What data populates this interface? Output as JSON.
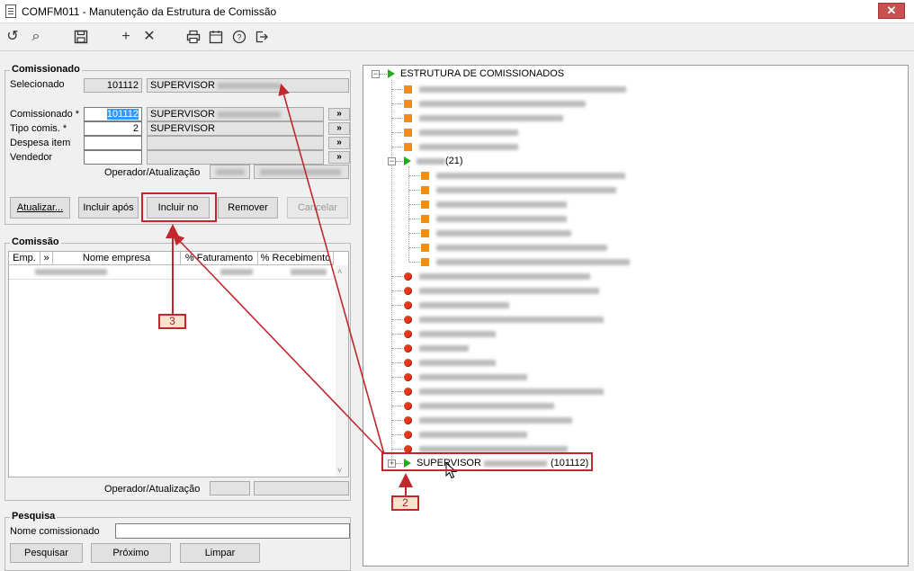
{
  "window": {
    "title": "COMFM011 - Manutenção da Estrutura de Comissão"
  },
  "toolbar_icons": [
    "undo-icon",
    "search-icon",
    "save-icon",
    "add-icon",
    "close-icon",
    "print-icon",
    "calendar-icon",
    "help-icon",
    "exit-icon"
  ],
  "comissionado": {
    "title": "Comissionado",
    "selecionado_label": "Selecionado",
    "selecionado_code": "101112",
    "selecionado_name": "SUPERVISOR",
    "comissionado_label": "Comissionado *",
    "comissionado_code": "101112",
    "comissionado_name": "SUPERVISOR",
    "tipo_label": "Tipo comis. *",
    "tipo_code": "2",
    "tipo_name": "SUPERVISOR",
    "despesa_label": "Despesa item",
    "vendedor_label": "Vendedor",
    "operador_label": "Operador/Atualização",
    "lookup_btn": "»"
  },
  "actions": {
    "atualizar": "Atualizar...",
    "incluir_apos": "Incluir após",
    "incluir_no": "Incluir no",
    "remover": "Remover",
    "cancelar": "Cancelar"
  },
  "comissao": {
    "title": "Comissão",
    "columns": [
      "Emp.",
      "»",
      "Nome empresa",
      "% Faturamento",
      "% Recebimento"
    ],
    "operador_label": "Operador/Atualização"
  },
  "pesquisa": {
    "title": "Pesquisa",
    "nome_label": "Nome comissionado",
    "pesquisar": "Pesquisar",
    "proximo": "Próximo",
    "limpar": "Limpar"
  },
  "tree": {
    "root": "ESTRUTURA DE COMISSIONADOS",
    "group_count": "(21)",
    "selected_node_name": "SUPERVISOR",
    "selected_node_code": "(101112)"
  },
  "callouts": {
    "two": "2",
    "three": "3"
  },
  "colors": {
    "accent_red": "#c0282e",
    "node_orange": "#f28b1e",
    "node_red": "#e23a1a",
    "node_green": "#1fae1f"
  }
}
